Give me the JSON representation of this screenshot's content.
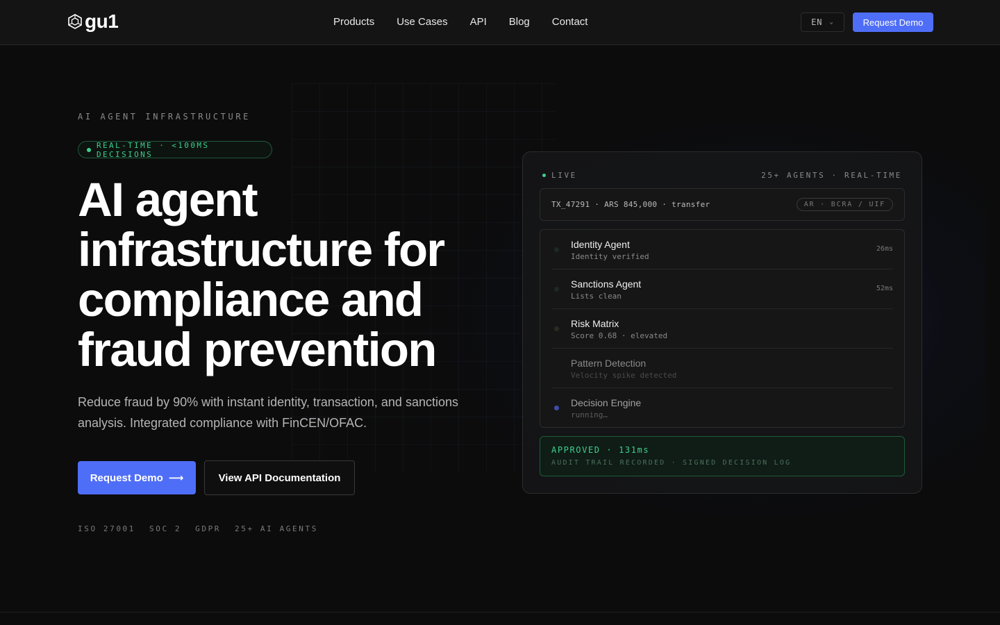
{
  "header": {
    "logo_text": "gu1",
    "nav": [
      "Products",
      "Use Cases",
      "API",
      "Blog",
      "Contact"
    ],
    "lang": "EN",
    "cta": "Request Demo"
  },
  "hero": {
    "eyebrow": "AI AGENT INFRASTRUCTURE",
    "pill": "REAL-TIME · <100MS DECISIONS",
    "headline_lines": [
      "AI agent",
      "infrastructure for",
      "compliance and",
      "fraud prevention"
    ],
    "subtitle": "Reduce fraud by 90% with instant identity, transaction, and sanctions analysis. Integrated compliance with FinCEN/OFAC.",
    "primary_cta": "Request Demo",
    "primary_cta_arrow": "⟶",
    "secondary_cta": "View API Documentation",
    "certs": [
      "ISO 27001",
      "SOC 2",
      "GDPR",
      "25+ AI AGENTS"
    ]
  },
  "panel": {
    "live_label": "LIVE",
    "agents_realtime": "25+ AGENTS · REAL-TIME",
    "transaction": "TX_47291 · ARS 845,000 · transfer",
    "region": "AR · BCRA / UIF",
    "agents": [
      {
        "name": "Identity Agent",
        "status": "Identity verified",
        "time": "26ms"
      },
      {
        "name": "Sanctions Agent",
        "status": "Lists clean",
        "time": "52ms"
      },
      {
        "name": "Risk Matrix",
        "status": "Score 0.68 · elevated",
        "time": ""
      },
      {
        "name": "Pattern Detection",
        "status": "Velocity spike detected",
        "time": ""
      },
      {
        "name": "Decision Engine",
        "status": "running…",
        "time": ""
      }
    ],
    "decision": "APPROVED · 131ms",
    "decision_sub": "AUDIT TRAIL RECORDED · SIGNED DECISION LOG"
  },
  "colors": {
    "accent": "#4f6ef7",
    "success": "#3fcf8e",
    "background": "#0c0c0c"
  }
}
